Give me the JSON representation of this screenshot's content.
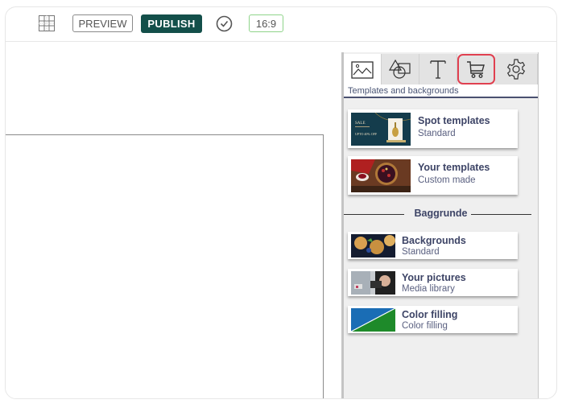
{
  "toolbar": {
    "grid_icon": "grid-icon",
    "preview_label": "PREVIEW",
    "publish_label": "PUBLISH",
    "check_icon": "check-circle-icon",
    "aspect_ratio": "16:9"
  },
  "panel": {
    "tabs": [
      {
        "name": "image",
        "icon": "image-icon",
        "active": true
      },
      {
        "name": "shapes",
        "icon": "shapes-icon",
        "active": false
      },
      {
        "name": "text",
        "icon": "text-icon",
        "active": false
      },
      {
        "name": "cart",
        "icon": "cart-icon",
        "active": false,
        "highlighted": true
      },
      {
        "name": "settings",
        "icon": "gear-icon",
        "active": false
      }
    ],
    "title": "Templates and backgrounds",
    "template_items": [
      {
        "title": "Spot templates",
        "subtitle": "Standard"
      },
      {
        "title": "Your templates",
        "subtitle": "Custom made"
      }
    ],
    "section_label": "Baggrunde",
    "background_items": [
      {
        "title": "Backgrounds",
        "subtitle": "Standard"
      },
      {
        "title": "Your pictures",
        "subtitle": "Media library"
      },
      {
        "title": "Color filling",
        "subtitle": "Color filling"
      }
    ]
  },
  "colors": {
    "publish_bg": "#134f4a",
    "ratio_border": "#8fd48a",
    "highlight": "#e04050",
    "title_text": "#3d4466",
    "fill_blue": "#1a6db5",
    "fill_green": "#1e8a2a"
  }
}
